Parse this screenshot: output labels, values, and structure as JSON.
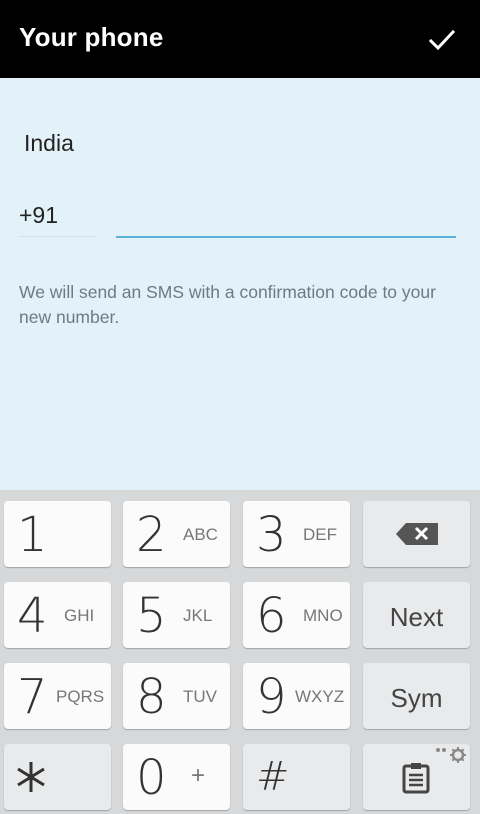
{
  "appbar": {
    "title": "Your phone",
    "confirm_icon": "check-icon"
  },
  "form": {
    "country": "India",
    "country_code": "+91",
    "phone_value": "",
    "hint": "We will send an SMS with a confirmation code to your new number."
  },
  "keyboard": {
    "keys": [
      {
        "num": "1",
        "letters": ""
      },
      {
        "num": "2",
        "letters": "ABC"
      },
      {
        "num": "3",
        "letters": "DEF"
      },
      {
        "num": "4",
        "letters": "GHI"
      },
      {
        "num": "5",
        "letters": "JKL"
      },
      {
        "num": "6",
        "letters": "MNO"
      },
      {
        "num": "7",
        "letters": "PQRS"
      },
      {
        "num": "8",
        "letters": "TUV"
      },
      {
        "num": "9",
        "letters": "WXYZ"
      },
      {
        "num": "*",
        "letters": ""
      },
      {
        "num": "0",
        "letters": "+"
      },
      {
        "num": "#",
        "letters": ""
      }
    ],
    "next_label": "Next",
    "sym_label": "Sym",
    "backspace_icon": "backspace-icon",
    "clipboard_icon": "clipboard-settings-icon"
  },
  "colors": {
    "appbar": "#000000",
    "background": "#e3f2f8",
    "accent_underline": "#5ab2d6",
    "keyboard_bg": "#d6d8da"
  }
}
